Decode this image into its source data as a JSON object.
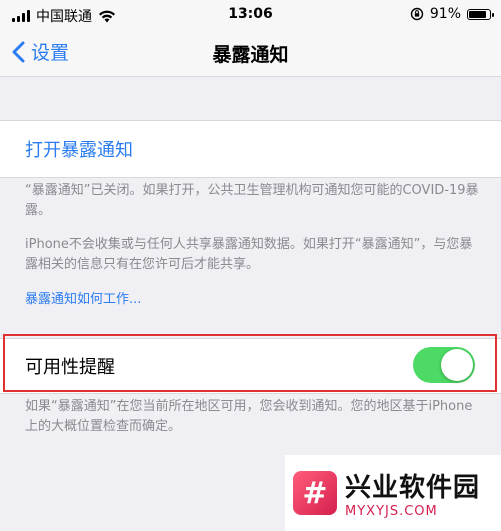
{
  "status_bar": {
    "carrier": "中国联通",
    "time": "13:06",
    "battery_percent": "91%",
    "battery_level": 0.91,
    "icons": [
      "signal-icon",
      "wifi-icon",
      "rotation-lock-icon",
      "battery-icon"
    ]
  },
  "nav": {
    "back_label": "设置",
    "title": "暴露通知"
  },
  "open_notifications_label": "打开暴露通知",
  "footer1": {
    "line1": "“暴露通知”已关闭。如果打开，公共卫生管理机构可通知您可能的COVID-19暴露。",
    "line2": "iPhone不会收集或与任何人共享暴露通知数据。如果打开“暴露通知”，与您暴露相关的信息只有在您许可后才能共享。",
    "link": "暴露通知如何工作..."
  },
  "availability": {
    "label": "可用性提醒",
    "enabled": true,
    "footer": "如果“暴露通知”在您当前所在地区可用，您会收到通知。您的地区基于iPhone上的大概位置检查而确定。"
  },
  "watermark": {
    "logo_glyph": "#",
    "name": "兴业软件园",
    "url": "MYXYJS.COM"
  },
  "colors": {
    "accent": "#2b7cf0",
    "toggle_on": "#4cd964",
    "highlight_border": "#e03030",
    "background": "#efeff4"
  }
}
